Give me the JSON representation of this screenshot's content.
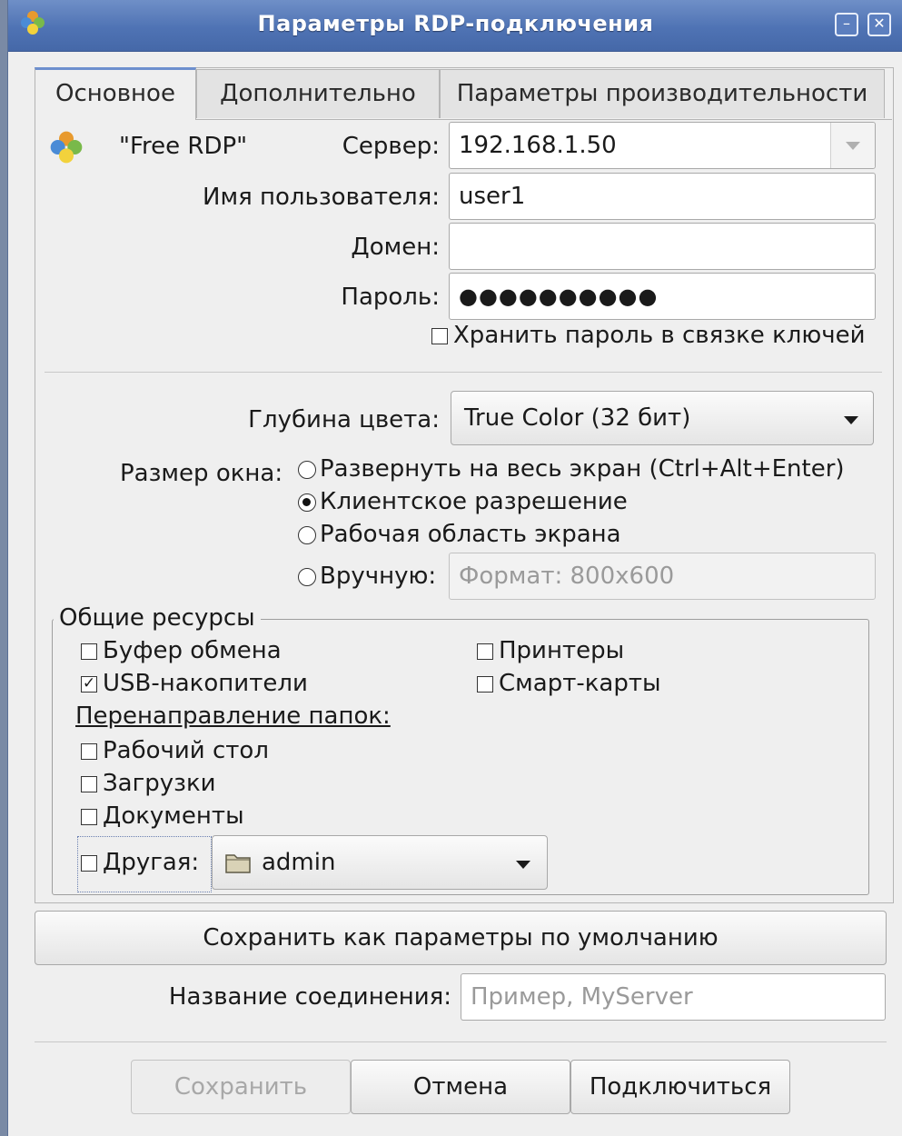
{
  "window": {
    "title": "Параметры RDP-подключения",
    "minimize_symbol": "–",
    "close_symbol": "✕",
    "app_icon": "freerdp-icon"
  },
  "tabs": [
    {
      "label": "Основное",
      "active": true
    },
    {
      "label": "Дополнительно",
      "active": false
    },
    {
      "label": "Параметры производительности",
      "active": false
    }
  ],
  "general": {
    "protocol_label": "\"Free RDP\"",
    "server_label": "Сервер:",
    "server_value": "192.168.1.50",
    "username_label": "Имя пользователя:",
    "username_value": "user1",
    "domain_label": "Домен:",
    "domain_value": "",
    "password_label": "Пароль:",
    "password_mask": "●●●●●●●●●●",
    "keyring_label": "Хранить пароль в связке ключей",
    "keyring_checked": false
  },
  "display": {
    "color_depth_label": "Глубина цвета:",
    "color_depth_value": "True Color (32 бит)",
    "window_size_label": "Размер окна:",
    "options": [
      {
        "label": "Развернуть на весь экран (Ctrl+Alt+Enter)",
        "selected": false
      },
      {
        "label": "Клиентское разрешение",
        "selected": true
      },
      {
        "label": "Рабочая область экрана",
        "selected": false
      },
      {
        "label": "Вручную:",
        "selected": false
      }
    ],
    "manual_placeholder": "Формат: 800x600"
  },
  "shared": {
    "title": "Общие ресурсы",
    "clipboard": {
      "label": "Буфер обмена",
      "checked": false
    },
    "printers": {
      "label": "Принтеры",
      "checked": false
    },
    "usb": {
      "label": "USB-накопители",
      "checked": true
    },
    "smartcards": {
      "label": "Смарт-карты",
      "checked": false
    },
    "folder_redirect_label": "Перенаправление папок:",
    "desktop": {
      "label": "Рабочий стол",
      "checked": false
    },
    "downloads": {
      "label": "Загрузки",
      "checked": false
    },
    "documents": {
      "label": "Документы",
      "checked": false
    },
    "other": {
      "label": "Другая:",
      "checked": false
    },
    "folder_value": "admin",
    "checkmark": "✓"
  },
  "footer": {
    "save_default_label": "Сохранить как параметры по умолчанию",
    "connection_name_label": "Название соединения:",
    "connection_name_placeholder": "Пример, MyServer",
    "save_label": "Сохранить",
    "cancel_label": "Отмена",
    "connect_label": "Подключиться"
  }
}
